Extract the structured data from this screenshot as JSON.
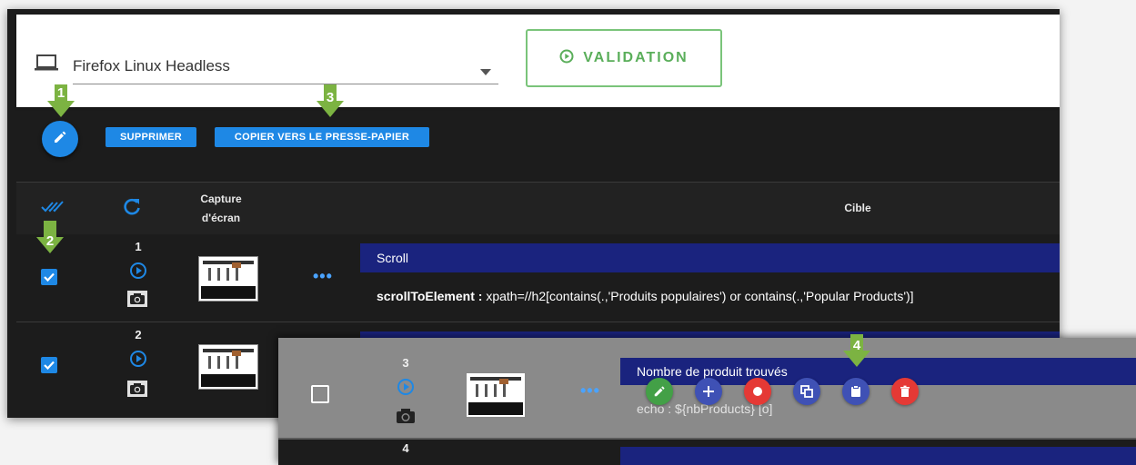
{
  "toolbar": {
    "browser_select": {
      "value": "Firefox Linux Headless",
      "icon": "laptop-icon"
    },
    "validation_button": {
      "label": "VALIDATION",
      "icon": "play-circle-icon"
    }
  },
  "actions": {
    "edit_fab_icon": "pencil-icon",
    "delete_label": "SUPPRIMER",
    "copy_label": "COPIER VERS LE PRESSE-PAPIER"
  },
  "table": {
    "headers": {
      "select_icon": "double-check-icon",
      "refresh_icon": "refresh-icon",
      "capture_label_line1": "Capture",
      "capture_label_line2": "d'écran",
      "target_label": "Cible"
    },
    "rows": [
      {
        "num": "1",
        "checked": true,
        "name": "Scroll",
        "command": "scrollToElement :",
        "target": " xpath=//h2[contains(.,'Produits populaires') or contains(.,'Popular Products')]"
      },
      {
        "num": "2",
        "checked": true,
        "name": "",
        "command": "",
        "target": ""
      }
    ]
  },
  "overlay_row": {
    "num": "3",
    "checked": false,
    "name": "Nombre de produit trouvés",
    "command": "echo : ${nbProducts} [o]",
    "next_num": "4",
    "action_buttons": [
      {
        "name": "edit",
        "icon": "pencil-icon",
        "color": "#43a047"
      },
      {
        "name": "add",
        "icon": "plus-icon",
        "color": "#3f51b5"
      },
      {
        "name": "record",
        "icon": "record-icon",
        "color": "#e53935"
      },
      {
        "name": "duplicate",
        "icon": "duplicate-icon",
        "color": "#3f51b5"
      },
      {
        "name": "clipboard",
        "icon": "clipboard-icon",
        "color": "#3f51b5"
      },
      {
        "name": "delete",
        "icon": "trash-icon",
        "color": "#e53935"
      }
    ]
  },
  "annotations": [
    "1",
    "2",
    "3",
    "4"
  ],
  "colors": {
    "accent_blue": "#1e88e5",
    "dark_bg": "#1c1c1c",
    "row_bar": "#1a237e",
    "annotation_green": "#7cb342",
    "validation_green": "#5aae5a"
  }
}
